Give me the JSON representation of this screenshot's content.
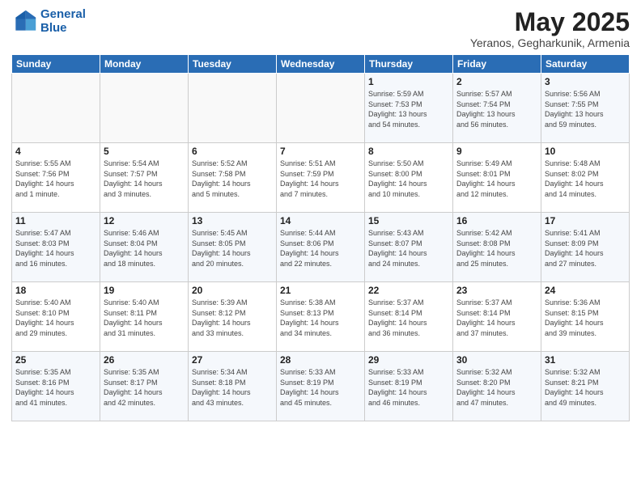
{
  "header": {
    "logo_line1": "General",
    "logo_line2": "Blue",
    "month": "May 2025",
    "location": "Yeranos, Gegharkunik, Armenia"
  },
  "days": [
    "Sunday",
    "Monday",
    "Tuesday",
    "Wednesday",
    "Thursday",
    "Friday",
    "Saturday"
  ],
  "weeks": [
    [
      {
        "day": "",
        "info": ""
      },
      {
        "day": "",
        "info": ""
      },
      {
        "day": "",
        "info": ""
      },
      {
        "day": "",
        "info": ""
      },
      {
        "day": "1",
        "info": "Sunrise: 5:59 AM\nSunset: 7:53 PM\nDaylight: 13 hours\nand 54 minutes."
      },
      {
        "day": "2",
        "info": "Sunrise: 5:57 AM\nSunset: 7:54 PM\nDaylight: 13 hours\nand 56 minutes."
      },
      {
        "day": "3",
        "info": "Sunrise: 5:56 AM\nSunset: 7:55 PM\nDaylight: 13 hours\nand 59 minutes."
      }
    ],
    [
      {
        "day": "4",
        "info": "Sunrise: 5:55 AM\nSunset: 7:56 PM\nDaylight: 14 hours\nand 1 minute."
      },
      {
        "day": "5",
        "info": "Sunrise: 5:54 AM\nSunset: 7:57 PM\nDaylight: 14 hours\nand 3 minutes."
      },
      {
        "day": "6",
        "info": "Sunrise: 5:52 AM\nSunset: 7:58 PM\nDaylight: 14 hours\nand 5 minutes."
      },
      {
        "day": "7",
        "info": "Sunrise: 5:51 AM\nSunset: 7:59 PM\nDaylight: 14 hours\nand 7 minutes."
      },
      {
        "day": "8",
        "info": "Sunrise: 5:50 AM\nSunset: 8:00 PM\nDaylight: 14 hours\nand 10 minutes."
      },
      {
        "day": "9",
        "info": "Sunrise: 5:49 AM\nSunset: 8:01 PM\nDaylight: 14 hours\nand 12 minutes."
      },
      {
        "day": "10",
        "info": "Sunrise: 5:48 AM\nSunset: 8:02 PM\nDaylight: 14 hours\nand 14 minutes."
      }
    ],
    [
      {
        "day": "11",
        "info": "Sunrise: 5:47 AM\nSunset: 8:03 PM\nDaylight: 14 hours\nand 16 minutes."
      },
      {
        "day": "12",
        "info": "Sunrise: 5:46 AM\nSunset: 8:04 PM\nDaylight: 14 hours\nand 18 minutes."
      },
      {
        "day": "13",
        "info": "Sunrise: 5:45 AM\nSunset: 8:05 PM\nDaylight: 14 hours\nand 20 minutes."
      },
      {
        "day": "14",
        "info": "Sunrise: 5:44 AM\nSunset: 8:06 PM\nDaylight: 14 hours\nand 22 minutes."
      },
      {
        "day": "15",
        "info": "Sunrise: 5:43 AM\nSunset: 8:07 PM\nDaylight: 14 hours\nand 24 minutes."
      },
      {
        "day": "16",
        "info": "Sunrise: 5:42 AM\nSunset: 8:08 PM\nDaylight: 14 hours\nand 25 minutes."
      },
      {
        "day": "17",
        "info": "Sunrise: 5:41 AM\nSunset: 8:09 PM\nDaylight: 14 hours\nand 27 minutes."
      }
    ],
    [
      {
        "day": "18",
        "info": "Sunrise: 5:40 AM\nSunset: 8:10 PM\nDaylight: 14 hours\nand 29 minutes."
      },
      {
        "day": "19",
        "info": "Sunrise: 5:40 AM\nSunset: 8:11 PM\nDaylight: 14 hours\nand 31 minutes."
      },
      {
        "day": "20",
        "info": "Sunrise: 5:39 AM\nSunset: 8:12 PM\nDaylight: 14 hours\nand 33 minutes."
      },
      {
        "day": "21",
        "info": "Sunrise: 5:38 AM\nSunset: 8:13 PM\nDaylight: 14 hours\nand 34 minutes."
      },
      {
        "day": "22",
        "info": "Sunrise: 5:37 AM\nSunset: 8:14 PM\nDaylight: 14 hours\nand 36 minutes."
      },
      {
        "day": "23",
        "info": "Sunrise: 5:37 AM\nSunset: 8:14 PM\nDaylight: 14 hours\nand 37 minutes."
      },
      {
        "day": "24",
        "info": "Sunrise: 5:36 AM\nSunset: 8:15 PM\nDaylight: 14 hours\nand 39 minutes."
      }
    ],
    [
      {
        "day": "25",
        "info": "Sunrise: 5:35 AM\nSunset: 8:16 PM\nDaylight: 14 hours\nand 41 minutes."
      },
      {
        "day": "26",
        "info": "Sunrise: 5:35 AM\nSunset: 8:17 PM\nDaylight: 14 hours\nand 42 minutes."
      },
      {
        "day": "27",
        "info": "Sunrise: 5:34 AM\nSunset: 8:18 PM\nDaylight: 14 hours\nand 43 minutes."
      },
      {
        "day": "28",
        "info": "Sunrise: 5:33 AM\nSunset: 8:19 PM\nDaylight: 14 hours\nand 45 minutes."
      },
      {
        "day": "29",
        "info": "Sunrise: 5:33 AM\nSunset: 8:19 PM\nDaylight: 14 hours\nand 46 minutes."
      },
      {
        "day": "30",
        "info": "Sunrise: 5:32 AM\nSunset: 8:20 PM\nDaylight: 14 hours\nand 47 minutes."
      },
      {
        "day": "31",
        "info": "Sunrise: 5:32 AM\nSunset: 8:21 PM\nDaylight: 14 hours\nand 49 minutes."
      }
    ]
  ]
}
